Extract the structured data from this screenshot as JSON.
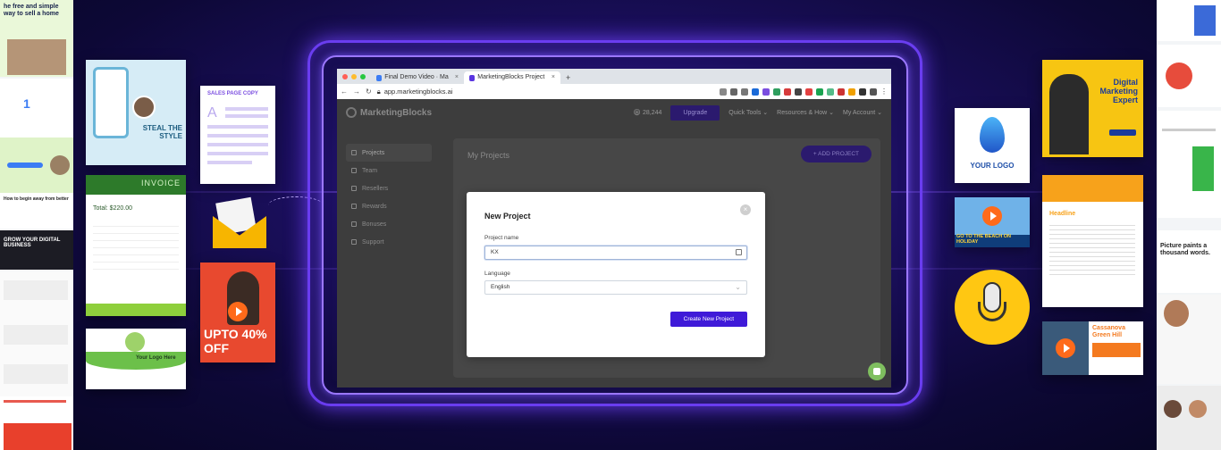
{
  "left_strip": {
    "top_heading": "he free and simple way to sell a home",
    "mid_text_1": "GROW YOUR DIGITAL BUSINESS",
    "banner_text": "How to begin away from better"
  },
  "left_thumbs": {
    "fashion_title": "STEAL THE STYLE",
    "sales_page_title": "SALES PAGE COPY",
    "invoice_title": "INVOICE",
    "invoice_total": "Total: $220.00",
    "promo_text": "UPTO 40% OFF",
    "logo_text": "Your Logo Here"
  },
  "browser": {
    "tabs": [
      {
        "label": "Final Demo Video · Marketing",
        "active": false
      },
      {
        "label": "MarketingBlocks Project",
        "active": true
      }
    ],
    "url": "app.marketingblocks.ai"
  },
  "app": {
    "logo": "MarketingBlocks",
    "credits": "28,244",
    "upgrade_label": "Upgrade",
    "nav_quick_tools": "Quick Tools ⌄",
    "nav_resources": "Resources & How ⌄",
    "nav_account": "My Account ⌄",
    "sidebar": [
      {
        "label": "Projects",
        "active": true
      },
      {
        "label": "Team",
        "active": false
      },
      {
        "label": "Resellers",
        "active": false
      },
      {
        "label": "Rewards",
        "active": false
      },
      {
        "label": "Bonuses",
        "active": false
      },
      {
        "label": "Support",
        "active": false
      }
    ],
    "page_title": "My Projects",
    "add_project_label": "+ ADD PROJECT"
  },
  "modal": {
    "title": "New Project",
    "project_name_label": "Project name",
    "project_name_value": "KX",
    "language_label": "Language",
    "language_value": "English",
    "create_button": "Create New Project"
  },
  "right_items": {
    "digital_marketing_title": "Digital Marketing Expert",
    "your_logo": "YOUR LOGO",
    "beach_text": "GO TO THE BEACH ON HOLIDAY",
    "brochure_title": "Headline",
    "real_estate_title": "Cassanova Green Hill",
    "right_strip_text": "Picture paints a thousand words."
  }
}
